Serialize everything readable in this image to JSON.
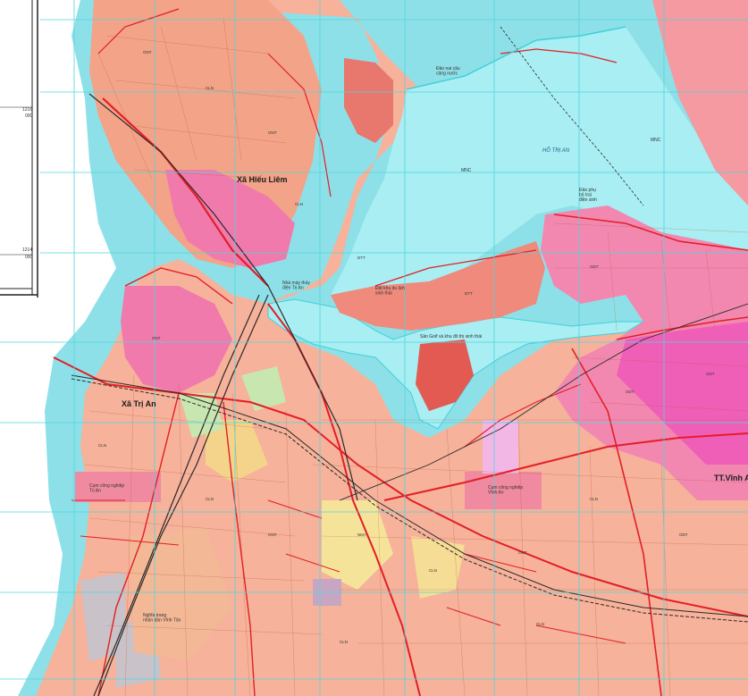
{
  "map": {
    "places": {
      "xa_hieu_liem": "Xã Hiếu Liêm",
      "xa_tri_an": "Xã Trị An",
      "tt_vinh_an": "TT.Vĩnh An"
    },
    "water": {
      "ho_tri_an": "HỒ TRỊ AN",
      "mnc_1": "MNC",
      "mnc_2": "MNC"
    },
    "annotations": {
      "dao_ca": "Đảo nai câu\ncảng nước",
      "cum_cn_tri_an": "Cụm công nghiệp\nTrị An",
      "cum_cn_vinh_an": "Cụm công nghiệp\nVĩnh An",
      "nghia_trang": "Nghĩa trang\nnhân dân Vĩnh Tân",
      "nha_may_thuy_dien": "Nhà máy thủy\nđiện Trị An",
      "dao_phu": "Đảo phụ\nbộ trai\nđiện sinh",
      "dat_khu_du_lich": "Đất khu du lịch\nsinh thái",
      "san_golf": "Sân Golf và khu đô thị sinh thái"
    },
    "grid_labels": {
      "g1": "1216",
      "g1b": "000",
      "g2": "1214",
      "g2b": "000"
    },
    "colors": {
      "water": "#a8eef2",
      "water_edge": "#3fd0d8",
      "residential": "#f7b59a",
      "agri": "#f3a98f",
      "urban": "#f08aa6",
      "road": "#e8202a",
      "industrial": "#e6c5e8",
      "forest": "#c8e6b0",
      "grid": "#4fd6df",
      "protection": "#d76a7a"
    }
  }
}
